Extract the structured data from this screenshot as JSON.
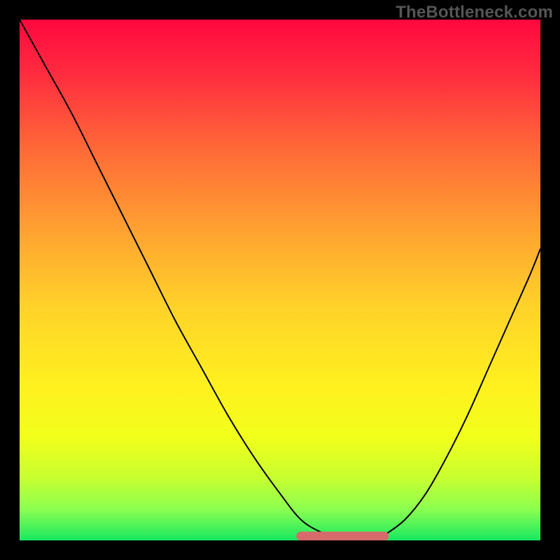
{
  "watermark": "TheBottleneck.com",
  "colors": {
    "background": "#000000",
    "gradient_stops": [
      {
        "offset": 0.0,
        "color": "#ff083f"
      },
      {
        "offset": 0.1,
        "color": "#ff2a3f"
      },
      {
        "offset": 0.25,
        "color": "#ff6a38"
      },
      {
        "offset": 0.4,
        "color": "#ffa031"
      },
      {
        "offset": 0.55,
        "color": "#ffd22a"
      },
      {
        "offset": 0.7,
        "color": "#fff01f"
      },
      {
        "offset": 0.8,
        "color": "#f2ff1a"
      },
      {
        "offset": 0.88,
        "color": "#c8ff30"
      },
      {
        "offset": 0.94,
        "color": "#8cff50"
      },
      {
        "offset": 1.0,
        "color": "#18e860"
      }
    ],
    "curve_stroke": "#000000",
    "flat_segment": "#d76a6a"
  },
  "chart_data": {
    "type": "line",
    "title": "",
    "xlabel": "",
    "ylabel": "",
    "xlim": [
      0,
      100
    ],
    "ylim": [
      0,
      100
    ],
    "series": [
      {
        "name": "curve",
        "x": [
          0,
          5,
          10,
          15,
          20,
          25,
          30,
          35,
          40,
          45,
          50,
          54,
          58,
          62,
          66,
          68,
          70,
          74,
          78,
          82,
          86,
          90,
          94,
          98,
          100
        ],
        "y": [
          100,
          91,
          82,
          72,
          62,
          52,
          42,
          33,
          24,
          16,
          9,
          4,
          1.5,
          0,
          0,
          0,
          1,
          4,
          9,
          16,
          24,
          33,
          42,
          51,
          56
        ]
      }
    ],
    "flat_region": {
      "x_start": 54,
      "x_end": 70,
      "y": 0
    }
  }
}
